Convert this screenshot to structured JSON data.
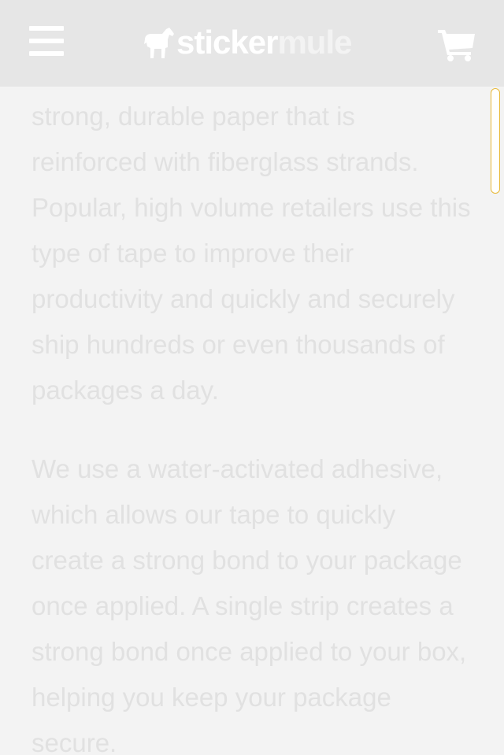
{
  "header": {
    "logo": {
      "primary": "sticker",
      "secondary": "mule"
    },
    "menu_icon": "hamburger-menu-icon",
    "cart_icon": "shopping-cart-icon"
  },
  "content": {
    "paragraphs": [
      "strong, durable paper that is reinforced with fiberglass strands. Popular, high volume retailers use this type of tape to improve their productivity and quickly and securely ship hundreds or even thousands of packages a day.",
      "We use a water-activated adhesive, which allows our tape to quickly create a strong bond to your package once applied. A single strip creates a strong bond once applied to your box, helping you keep your package secure."
    ]
  },
  "colors": {
    "header_background": "#e6e6e6",
    "page_background": "#f3f3f3",
    "text": "#e1e1e1",
    "scroll_thumb_border": "#e8b93a"
  }
}
